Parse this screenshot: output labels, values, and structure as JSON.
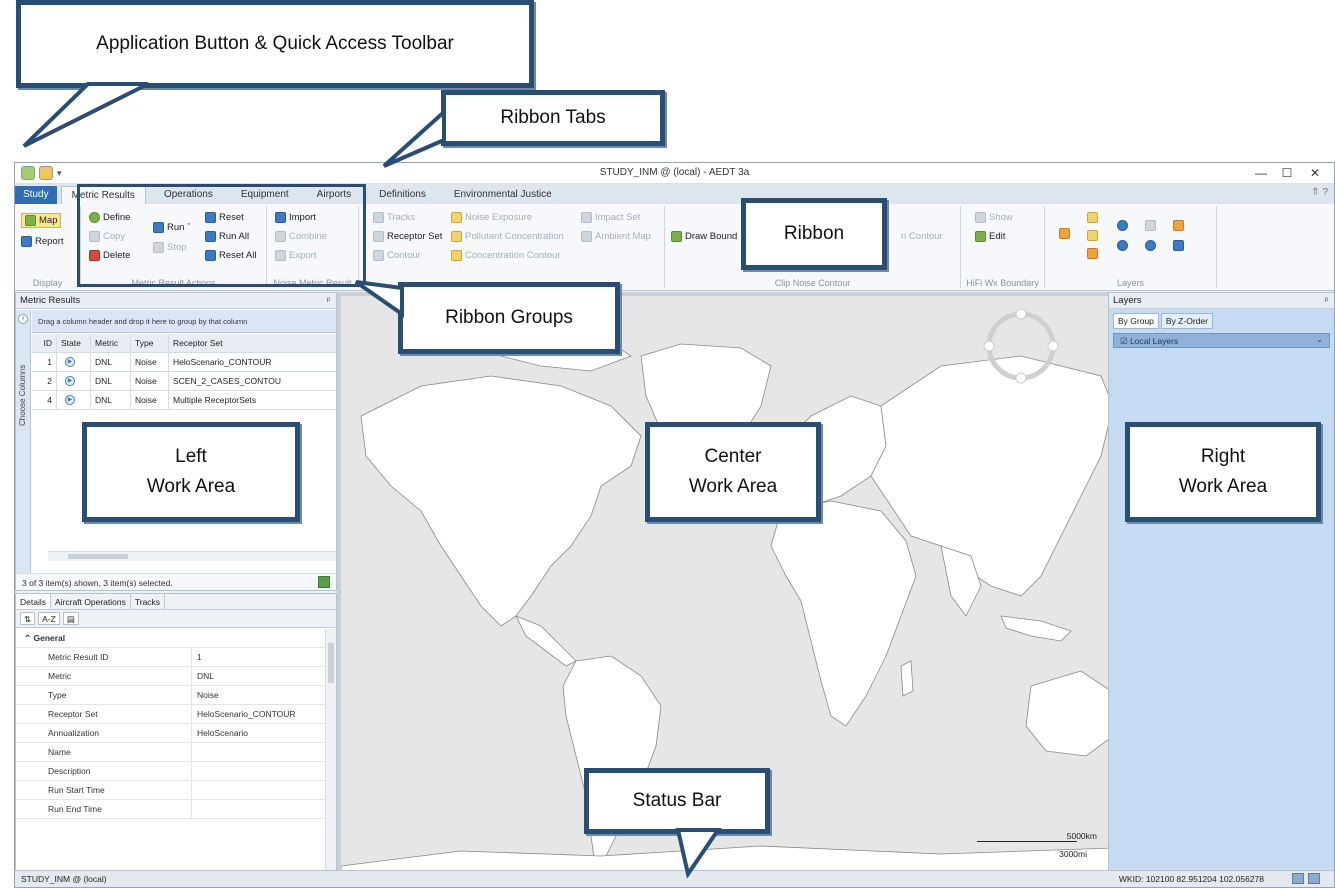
{
  "window": {
    "title": "STUDY_INM @ (local) - AEDT 3a",
    "controls": [
      "—",
      "☐",
      "✕"
    ]
  },
  "tabs": {
    "app_tab": "Study",
    "items": [
      "Metric Results",
      "Operations",
      "Equipment",
      "Airports",
      "Definitions",
      "Environmental Justice"
    ],
    "right": "⇑ ?"
  },
  "ribbon": {
    "display": {
      "map": "Map",
      "report": "Report",
      "label": "Display"
    },
    "metric_actions": {
      "define": "Define",
      "copy": "Copy",
      "delete": "Delete",
      "run": "Run ˇ",
      "stop": "Stop",
      "reset": "Reset",
      "run_all": "Run All",
      "reset_all": "Reset All",
      "label": "Metric Result Actions"
    },
    "noise_metric": {
      "import": "Import",
      "combine": "Combine",
      "export": "Export",
      "label": "Noise Metric Result"
    },
    "view": {
      "tracks": "Tracks",
      "receptor_set": "Receptor Set",
      "contour": "Contour",
      "noise_exposure": "Noise Exposure",
      "pollutant_concentration": "Pollutant Concentration",
      "concentration_contour": "Concentration Contour",
      "impact_set": "Impact Set",
      "ambient_map": "Ambient Map"
    },
    "clip": {
      "draw_bound": "Draw Bound",
      "contour": "n Contour",
      "label": "Clip Noise Contour"
    },
    "hifi": {
      "show": "Show",
      "edit": "Edit",
      "label": "HiFi Wx Boundary"
    },
    "layers": {
      "label": "Layers"
    }
  },
  "left_panel": {
    "title": "Metric Results",
    "pin": "ᵖ",
    "group_hint": "Drag a column header and drop it here to group by that column",
    "choose_columns": "Choose Columns",
    "columns": [
      "ID",
      "State",
      "Metric",
      "Type",
      "Receptor Set"
    ],
    "rows": [
      {
        "id": "1",
        "metric": "DNL",
        "type": "Noise",
        "receptor_set": "HeloScenario_CONTOUR"
      },
      {
        "id": "2",
        "metric": "DNL",
        "type": "Noise",
        "receptor_set": "SCEN_2_CASES_CONTOU"
      },
      {
        "id": "4",
        "metric": "DNL",
        "type": "Noise",
        "receptor_set": "Multiple ReceptorSets"
      }
    ],
    "status": "3 of 3 item(s) shown, 3 item(s) selected."
  },
  "details": {
    "tabs": [
      "Details",
      "Aircraft Operations",
      "Tracks"
    ],
    "toolbar": [
      "⇅",
      "A-Z",
      "▤"
    ],
    "category": "General",
    "props": [
      {
        "name": "Metric Result ID",
        "value": "1"
      },
      {
        "name": "Metric",
        "value": "DNL"
      },
      {
        "name": "Type",
        "value": "Noise"
      },
      {
        "name": "Receptor Set",
        "value": "HeloScenario_CONTOUR"
      },
      {
        "name": "Annualization",
        "value": "HeloScenario"
      },
      {
        "name": "Name",
        "value": ""
      },
      {
        "name": "Description",
        "value": ""
      },
      {
        "name": "Run Start Time",
        "value": ""
      },
      {
        "name": "Run End Time",
        "value": ""
      }
    ]
  },
  "map": {
    "scale_km": "5000km",
    "scale_mi": "3000mi"
  },
  "right_panel": {
    "title": "Layers",
    "tabs": [
      "By Group",
      "By Z-Order"
    ],
    "local_layers": "Local Layers"
  },
  "status_bar": {
    "left": "STUDY_INM @ (local)",
    "right": "WKID: 102100  82.951204 102.056278"
  },
  "callouts": {
    "app_button": "Application Button & Quick Access Toolbar",
    "ribbon_tabs": "Ribbon Tabs",
    "ribbon": "Ribbon",
    "ribbon_groups": "Ribbon Groups",
    "left_area_1": "Left",
    "left_area_2": "Work Area",
    "center_area_1": "Center",
    "center_area_2": "Work Area",
    "right_area_1": "Right",
    "right_area_2": "Work Area",
    "status_bar": "Status Bar"
  }
}
